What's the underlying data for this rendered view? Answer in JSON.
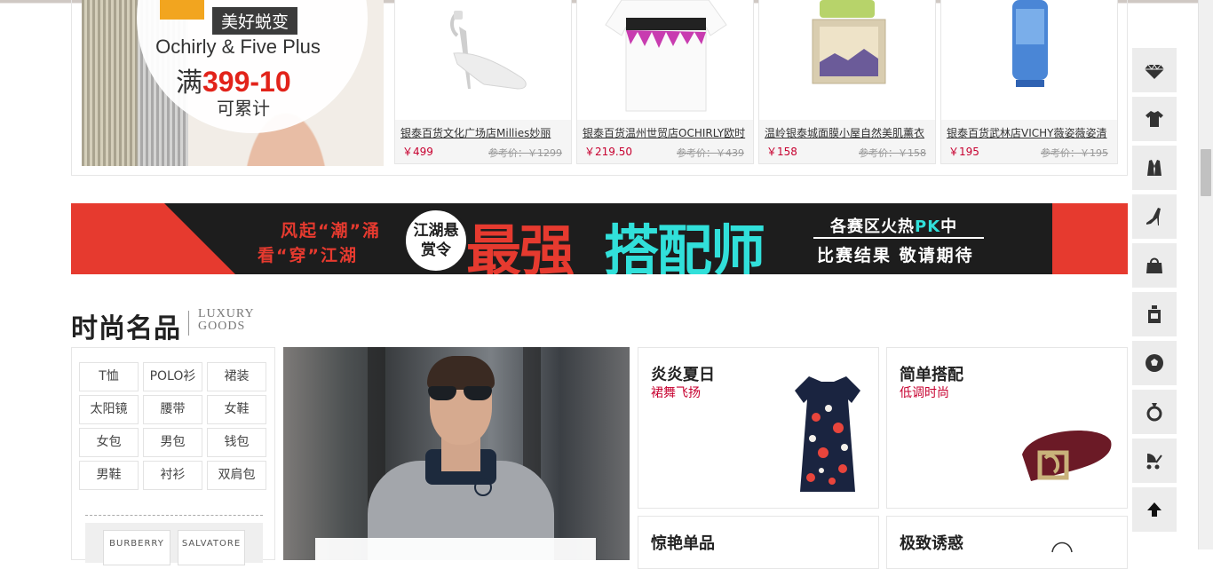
{
  "promo": {
    "tag": "美好蜕变",
    "brand": "Ochirly & Five Plus",
    "deal_prefix": "满",
    "deal_amount": "399-10",
    "note": "可累计"
  },
  "products": [
    {
      "name": "银泰百货文化广场店Millies妙丽",
      "price": "￥499",
      "ref": "参考价：￥1299"
    },
    {
      "name": "银泰百货温州世贸店OCHIRLY欧时",
      "price": "￥219.50",
      "ref": "参考价：￥439"
    },
    {
      "name": "温岭银泰城面膜小屋自然美肌薰衣",
      "price": "￥158",
      "ref": "参考价：￥158"
    },
    {
      "name": "银泰百货武林店VICHY薇姿薇姿清",
      "price": "￥195",
      "ref": "参考价：￥195"
    }
  ],
  "banner": {
    "slogan1": "风起“潮”涌",
    "slogan2": "看“穿”江湖",
    "badge": "江湖悬赏令",
    "title_part1": "最强",
    "title_part2": "搭配师",
    "side_line1_a": "各赛区火热",
    "side_line1_pk": "PK",
    "side_line1_b": "中",
    "side_line2": "比赛结果 敬请期待"
  },
  "section": {
    "title": "时尚名品",
    "en_line1": "LUXURY",
    "en_line2": "GOODS"
  },
  "categories": [
    "T恤",
    "POLO衫",
    "裙装",
    "太阳镜",
    "腰带",
    "女鞋",
    "女包",
    "男包",
    "钱包",
    "男鞋",
    "衬衫",
    "双肩包"
  ],
  "brands": [
    "BURBERRY",
    "SALVATORE"
  ],
  "cards": [
    {
      "title": "炎炎夏日",
      "subtitle": "裙舞飞扬"
    },
    {
      "title": "简单搭配",
      "subtitle": "低调时尚"
    },
    {
      "title": "惊艳单品",
      "subtitle": ""
    },
    {
      "title": "极致诱惑",
      "subtitle": ""
    }
  ],
  "sidebar_icons": [
    "diamond-icon",
    "tshirt-icon",
    "suit-icon",
    "high-heel-icon",
    "handbag-icon",
    "perfume-icon",
    "soccer-ball-icon",
    "ring-icon",
    "stroller-icon",
    "back-to-top-icon"
  ],
  "colors": {
    "accent_red": "#e63a2f",
    "price_red": "#c7002f",
    "cyan": "#31e0da"
  }
}
